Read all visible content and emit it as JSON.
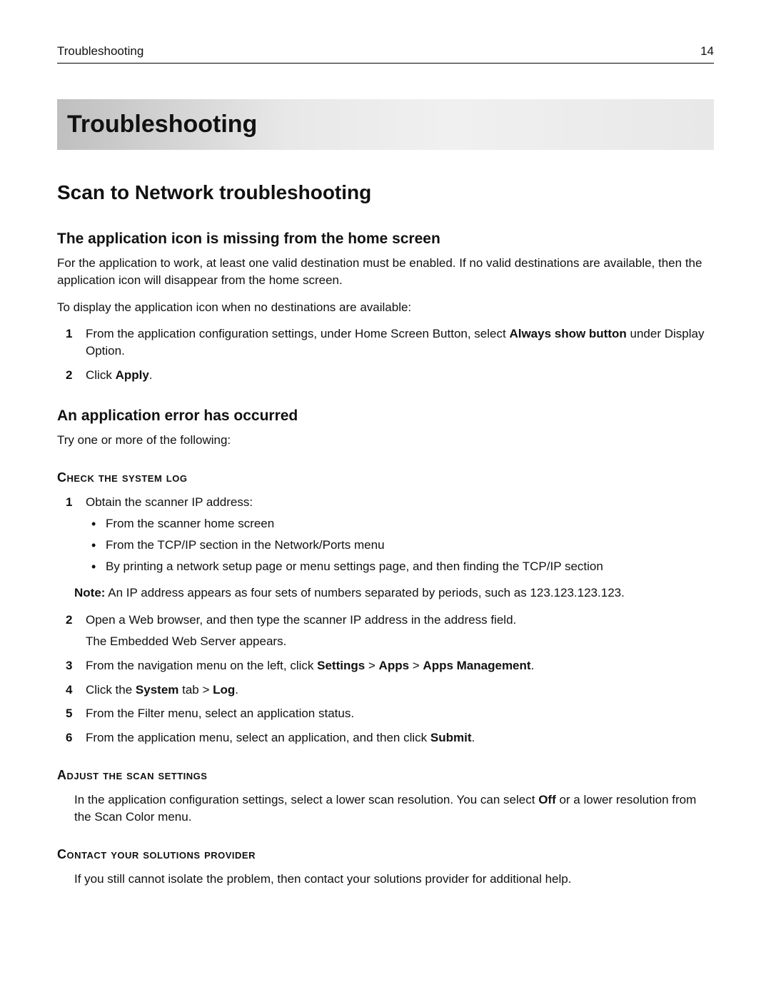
{
  "header": {
    "section": "Troubleshooting",
    "page": "14"
  },
  "h1": "Troubleshooting",
  "h2": "Scan to Network troubleshooting",
  "sub1": {
    "title": "The application icon is missing from the home screen",
    "p1": "For the application to work, at least one valid destination must be enabled. If no valid destinations are available, then the application icon will disappear from the home screen.",
    "p2": "To display the application icon when no destinations are available:",
    "step1_a": "From the application configuration settings, under Home Screen Button, select ",
    "step1_bold": "Always show button",
    "step1_b": " under Display Option.",
    "step2_a": "Click ",
    "step2_bold": "Apply",
    "step2_b": "."
  },
  "sub2": {
    "title": "An application error has occurred",
    "p1": "Try one or more of the following:",
    "checklog": {
      "heading": "Check the system log",
      "s1": "Obtain the scanner IP address:",
      "b1": "From the scanner home screen",
      "b2": "From the TCP/IP section in the Network/Ports menu",
      "b3": "By printing a network setup page or menu settings page, and then finding the TCP/IP section",
      "note_label": "Note:",
      "note_text": " An IP address appears as four sets of numbers separated by periods, such as 123.123.123.123.",
      "s2a": "Open a Web browser, and then type the scanner IP address in the address field.",
      "s2b": "The Embedded Web Server appears.",
      "s3_a": "From the navigation menu on the left, click ",
      "s3_b1": "Settings",
      "s3_gt1": " > ",
      "s3_b2": "Apps",
      "s3_gt2": " > ",
      "s3_b3": "Apps Management",
      "s3_end": ".",
      "s4_a": "Click the ",
      "s4_b1": "System",
      "s4_mid": " tab > ",
      "s4_b2": "Log",
      "s4_end": ".",
      "s5": "From the Filter menu, select an application status.",
      "s6_a": "From the application menu, select an application, and then click ",
      "s6_b": "Submit",
      "s6_end": "."
    },
    "adjust": {
      "heading": "Adjust the scan settings",
      "p_a": "In the application configuration settings, select a lower scan resolution. You can select ",
      "p_bold": "Off",
      "p_b": " or a lower resolution from the Scan Color menu."
    },
    "contact": {
      "heading": "Contact your solutions provider",
      "p": "If you still cannot isolate the problem, then contact your solutions provider for additional help."
    }
  }
}
